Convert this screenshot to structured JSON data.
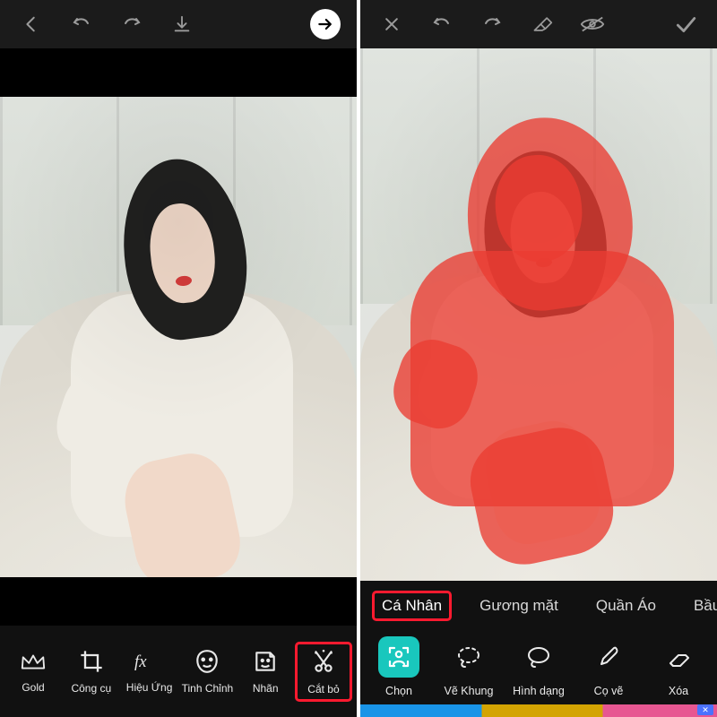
{
  "left": {
    "topbar_icons": [
      "back",
      "undo",
      "redo",
      "download",
      "next"
    ],
    "tools": [
      {
        "id": "gold",
        "label": "Gold",
        "icon": "crown-icon"
      },
      {
        "id": "tools",
        "label": "Công cụ",
        "icon": "crop-icon"
      },
      {
        "id": "fx",
        "label": "Hiệu Ứng",
        "icon": "fx-icon"
      },
      {
        "id": "retouch",
        "label": "Tinh Chỉnh",
        "icon": "face-icon"
      },
      {
        "id": "sticker",
        "label": "Nhãn",
        "icon": "sticker-icon"
      },
      {
        "id": "cutout",
        "label": "Cắt bỏ",
        "icon": "cutout-icon",
        "highlighted": true
      }
    ]
  },
  "right": {
    "topbar_icons": [
      "close",
      "undo",
      "redo",
      "eraser",
      "preview",
      "confirm"
    ],
    "chips": [
      {
        "label": "Cá Nhân",
        "active": true,
        "highlighted": true
      },
      {
        "label": "Gương mặt",
        "active": false
      },
      {
        "label": "Quần Áo",
        "active": false
      },
      {
        "label": "Bầu Trời",
        "active": false
      }
    ],
    "tools": [
      {
        "id": "select",
        "label": "Chọn",
        "icon": "person-select-icon",
        "selected": true
      },
      {
        "id": "outline",
        "label": "Vẽ Khung",
        "icon": "lasso-outline-icon"
      },
      {
        "id": "shape",
        "label": "Hình dạng",
        "icon": "lasso-shape-icon"
      },
      {
        "id": "brush",
        "label": "Cọ vẽ",
        "icon": "brush-icon"
      },
      {
        "id": "erase",
        "label": "Xóa",
        "icon": "eraser-icon"
      }
    ],
    "ad_close_glyph": "✕"
  },
  "colors": {
    "highlight": "#ff1a2f",
    "accent": "#19c7bd",
    "mask": "rgba(235,60,50,0.78)"
  }
}
